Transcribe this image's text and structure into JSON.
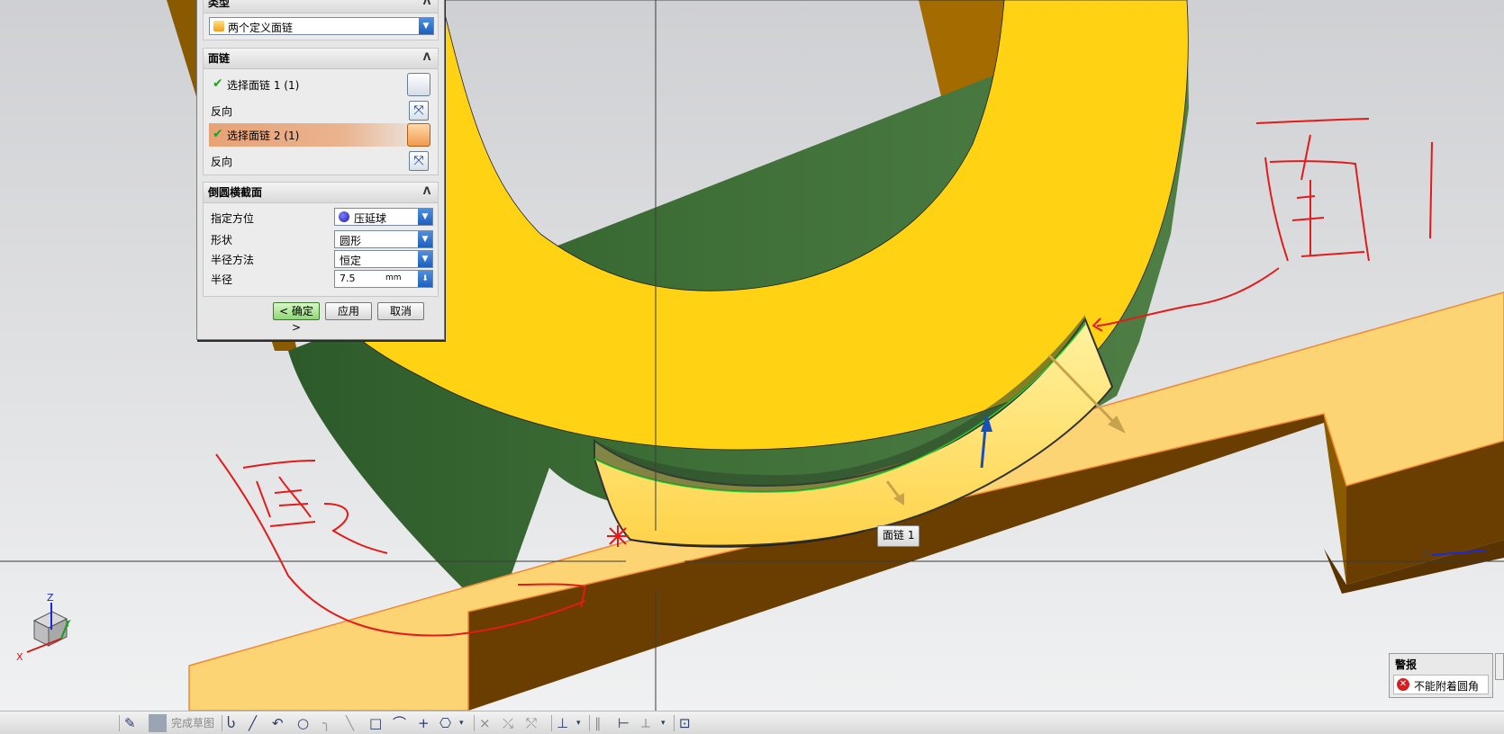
{
  "dialog": {
    "type_group_title": "类型",
    "type_value": "两个定义面链",
    "face_chain_group_title": "面链",
    "select_chain_1": "选择面链 1 (1)",
    "reverse_1": "反向",
    "select_chain_2": "选择面链 2 (1)",
    "reverse_2": "反向",
    "cross_section_group_title": "倒圆横截面",
    "orientation_label": "指定方位",
    "orientation_value": "压延球",
    "shape_label": "形状",
    "shape_value": "圆形",
    "radius_method_label": "半径方法",
    "radius_method_value": "恒定",
    "radius_label": "半径",
    "radius_value": "7.5",
    "radius_unit": "mm",
    "ok_button": "< 确定 >",
    "apply_button": "应用",
    "cancel_button": "取消"
  },
  "viewport": {
    "face_tooltip": "面链 1",
    "axis_x": "X",
    "axis_y": "Y",
    "axis_z": "Z",
    "view_axis_x": "X"
  },
  "warning": {
    "title": "警报",
    "message": "不能附着圆角"
  },
  "toolbar": {
    "finish_sketch": "完成草图"
  },
  "colors": {
    "model_yellow": "#ffd314",
    "model_green": "#3d6e36",
    "model_brown": "#6a3e00",
    "base_top": "#fdd473",
    "annotation_red": "#e21b1b",
    "background_top": "#d3d4d6",
    "background_bottom": "#eeeff0"
  }
}
